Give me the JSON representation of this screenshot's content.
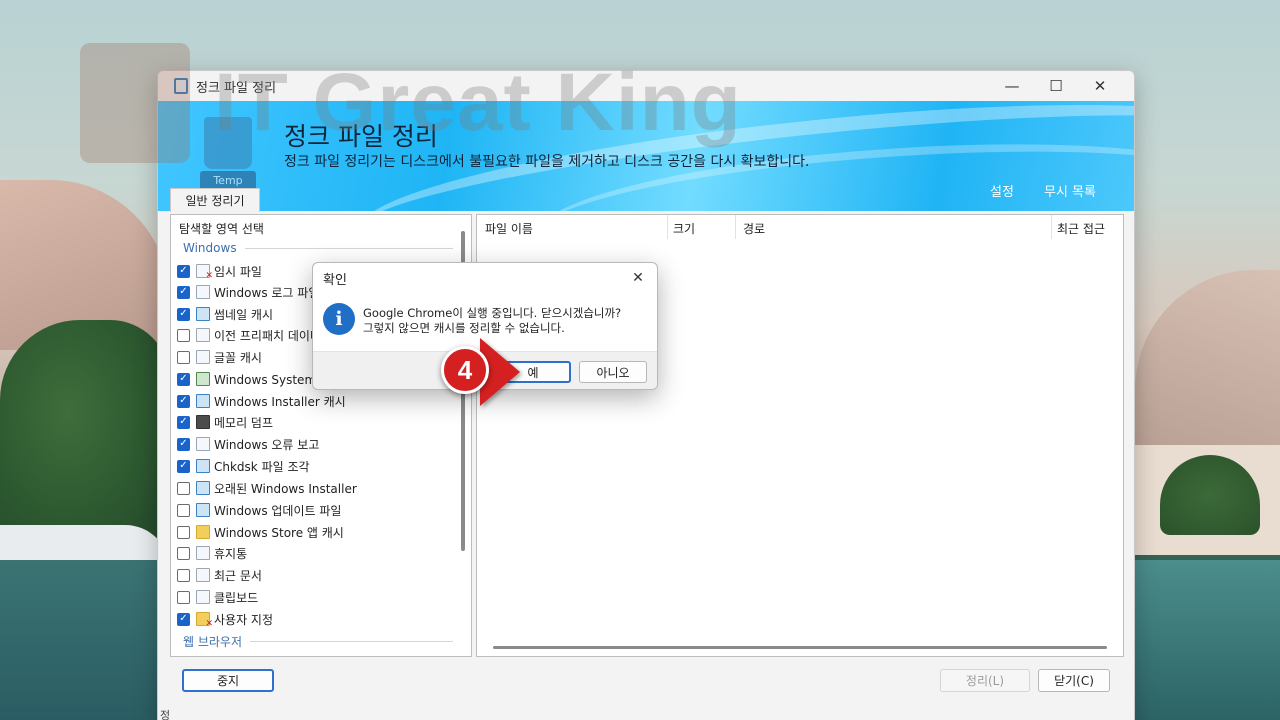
{
  "watermark": {
    "text": "IT Great King"
  },
  "window": {
    "title": "정크 파일 정리",
    "controls": {
      "minimize": "—",
      "maximize": "☐",
      "close": "✕"
    }
  },
  "banner": {
    "icon_label": "Temp",
    "title": "정크 파일 정리",
    "description": "정크 파일 정리기는 디스크에서 불필요한 파일을 제거하고 디스크 공간을 다시 확보합니다.",
    "settings_link": "설정",
    "ignore_link": "무시 목록"
  },
  "tab": {
    "label": "일반 정리기"
  },
  "left_pane": {
    "header": "탐색할 영역 선택",
    "group_windows": "Windows",
    "group_browser": "웹 브라우저",
    "items": [
      {
        "label": "임시 파일",
        "checked": true
      },
      {
        "label": "Windows 로그 파일",
        "checked": true
      },
      {
        "label": "썸네일 캐시",
        "checked": true
      },
      {
        "label": "이전 프리패치 데이터",
        "checked": false
      },
      {
        "label": "글꼴 캐시",
        "checked": false
      },
      {
        "label": "Windows System 캐시",
        "checked": true
      },
      {
        "label": "Windows Installer 캐시",
        "checked": true
      },
      {
        "label": "메모리 덤프",
        "checked": true
      },
      {
        "label": "Windows 오류 보고",
        "checked": true
      },
      {
        "label": "Chkdsk 파일 조각",
        "checked": true
      },
      {
        "label": "오래된 Windows Installer",
        "checked": false
      },
      {
        "label": "Windows 업데이트 파일",
        "checked": false
      },
      {
        "label": "Windows Store 앱 캐시",
        "checked": false
      },
      {
        "label": "휴지통",
        "checked": false
      },
      {
        "label": "최근 문서",
        "checked": false
      },
      {
        "label": "클립보드",
        "checked": false
      },
      {
        "label": "사용자 지정",
        "checked": true
      }
    ]
  },
  "right_pane": {
    "columns": [
      "파일 이름",
      "크기",
      "경로",
      "최근 접근"
    ]
  },
  "buttons": {
    "stop": "중지",
    "clean": "정리(L)",
    "close": "닫기(C)"
  },
  "status_mark": "정",
  "dialog": {
    "title": "확인",
    "message_line1": "Google Chrome이 실행 중입니다. 닫으시겠습니까?",
    "message_line2": "그렇지 않으면 캐시를 정리할 수 없습니다.",
    "info_icon": "i",
    "yes": "예",
    "no": "아니오",
    "close": "✕"
  },
  "step_badge": {
    "number": "4",
    "color": "#d42020"
  },
  "colors": {
    "accent": "#1a63c9",
    "banner": "#1fb5f5"
  }
}
